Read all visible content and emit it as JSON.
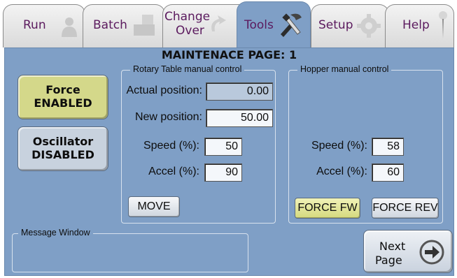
{
  "tabs": [
    {
      "label": "Run",
      "icon": "person-icon",
      "active": false
    },
    {
      "label": "Batch",
      "icon": "stack-icon",
      "active": false
    },
    {
      "label_line1": "Change",
      "label_line2": "Over",
      "icon": "changeover-arrow-icon",
      "active": false
    },
    {
      "label": "Tools",
      "icon": "tools-icon",
      "active": true
    },
    {
      "label": "Setup",
      "icon": "gear-icon",
      "active": false
    },
    {
      "label": "Help",
      "icon": "pin-icon",
      "active": false
    }
  ],
  "page_title": "MAINTENACE PAGE: 1",
  "force_button": {
    "line1": "Force",
    "line2": "ENABLED",
    "color": "#d4d88a"
  },
  "oscillator_button": {
    "line1": "Oscillator",
    "line2": "DISABLED",
    "color": "#c8d2de"
  },
  "rotary": {
    "title": "Rotary Table manual control",
    "actual_label": "Actual position:",
    "actual_value": "0.00",
    "new_label": "New position:",
    "new_value": "50.00",
    "speed_label": "Speed (%):",
    "speed_value": "50",
    "accel_label": "Accel (%):",
    "accel_value": "90",
    "move_label": "MOVE"
  },
  "hopper": {
    "title": "Hopper manual control",
    "speed_label": "Speed (%):",
    "speed_value": "58",
    "accel_label": "Accel (%):",
    "accel_value": "60",
    "force_fw_label": "FORCE FW",
    "force_rev_label": "FORCE REV"
  },
  "message_window": {
    "title": "Message Window"
  },
  "next_page": {
    "line1": "Next",
    "line2": "Page",
    "icon": "arrow-right-icon"
  },
  "colors": {
    "panel": "#7f9fc6",
    "tab_text": "#5b1a5e",
    "enabled": "#d4d88a"
  }
}
